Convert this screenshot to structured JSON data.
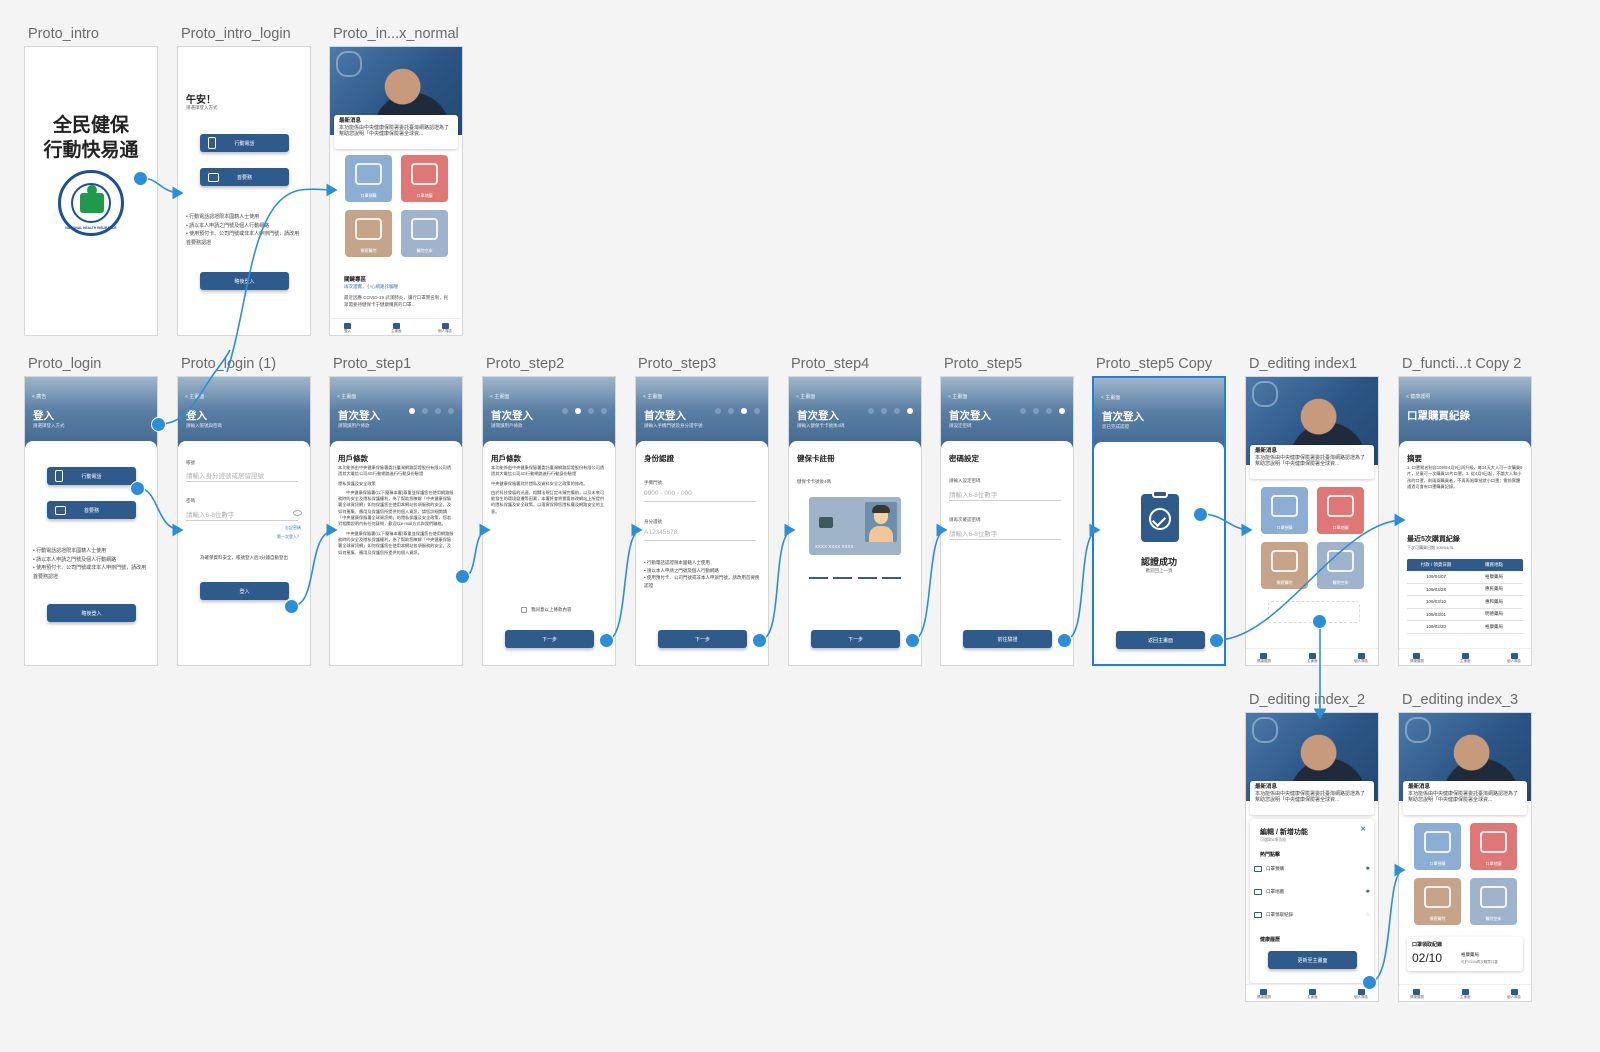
{
  "artboards": {
    "intro": "Proto_intro",
    "intro_login": "Proto_intro_login",
    "index_normal": "Proto_in...x_normal",
    "login": "Proto_login",
    "login1": "Proto_login (1)",
    "step1": "Proto_step1",
    "step2": "Proto_step2",
    "step3": "Proto_step3",
    "step4": "Proto_step4",
    "step5": "Proto_step5",
    "step5copy": "Proto_step5 Copy",
    "editing1": "D_editing index1",
    "functcopy": "D_functi...t Copy 2",
    "editing2": "D_editing index_2",
    "editing3": "D_editing index_3"
  },
  "intro": {
    "title1": "全民健保",
    "title2": "行動快易通",
    "logo_text": "NATIONAL HEALTH INSURANCE"
  },
  "intro_login": {
    "greeting": "午安！",
    "sub": "請選擇登入方式",
    "btn_phone": "行動電話",
    "btn_card": "首要務",
    "bullets": [
      "• 行動電話認證限本國籍人士使用",
      "• 請以本人申請之門號及個人行動網路",
      "• 使用預付卡、公司門號或非本人申辦門號，請改用首要務認證"
    ],
    "btn_skip": "略後登入"
  },
  "news": {
    "title": "最新消息",
    "body": "本功能係由中央健康保險署委託臺灣網路認證為了幫助您說明「中央健康保險署全球資..."
  },
  "tiles": {
    "mask": "口罩預購",
    "map": "口罩地圖",
    "hosp": "療癒醫院",
    "bed": "醫院空床"
  },
  "index_normal": {
    "topics": "關鍵專區",
    "topic_link": "再次證實，小心網路詐騙喔",
    "topic_body": "最近因應 COVID-19 武漢肺炎，讓行口罩實名制，民眾需要持健保卡于健康購買的口罩...",
    "nav": [
      "登入",
      "主畫面",
      "個人專區"
    ]
  },
  "login": {
    "back": "< 廣告",
    "title": "登入",
    "sub": "請選擇登入方式",
    "btn_phone": "行動電話",
    "btn_card": "首要務",
    "bullets": [
      "• 行動電話認證限本國籍人士使用",
      "• 請以本人申請之門號及個人行動網路",
      "• 使用預付卡、公司門號或非本人申辦門號，請改用首要務認證"
    ],
    "btn_skip": "略後登入"
  },
  "login1": {
    "back": "< 主畫面",
    "title": "登入",
    "sub": "請輸入帳號與密碼",
    "acct_label": "帳號",
    "acct_ph": "請輸入身分證號或居留證號",
    "pwd_label": "密碼",
    "pwd_ph": "請輸入6-8位數字",
    "forgot": "忘記密碼",
    "first": "第一次登入？",
    "note": "為確保資料安全，帳號登入后3分鐘自動登出",
    "btn": "登入"
  },
  "step1": {
    "back": "< 主畫面",
    "title": "首次登入",
    "sub": "請閱讀用戶條款",
    "section": "用戶條款",
    "p1": "本功能係由中央健康保險署委託臺灣網路認證股份有限公司透過其大電信公司4G行動網路進行行動身份驗證",
    "sub2": "隱私保護及安全政策",
    "p2": "中央健康保險署(以下簡稱本署)尊重並保護您在使用網路服務時的安全及隱私保護權利，為了幫助您瞭解「中央健康保險署全球資訊網」如何保護您在使用本網站各項服務的安全，及如何蒐集、應用及保護您所提供的個人資訊，請您詳細閱讀「中央健康保險署全球資訊網」的隱私保護及安全政策，您若對相關說明內有任何疑問，歡迎以e-mail方式與我們聯絡。",
    "p3": "中央健康保險署(以下簡稱本署)尊重並保護您在使用網路服務時的安全及隱私保護權利，為了幫助您瞭解「中央健康保險署全球資訊網」如何保護您在使用本網站各項服務的安全，及如何蒐集、應用及保護您所提供的個人資訊。"
  },
  "step2": {
    "back": "< 主畫面",
    "title": "首次登入",
    "sub": "請閱讀用戶條款",
    "section": "用戶條款",
    "p1": "本功能係由中央健康保險署委託臺灣網路認證股份有限公司透過其大電信公司4G行動網路進行行動身份驗證",
    "p2": "中央健康保險署對於隱私及資料安全之政策的修改。",
    "p3": "由於科技發展的迅速，相關法規訂定未臻完備前，以及未來可能發生的環境變遷等因素，本署將會將需要修改網站上所提供的隱私保護及安全政策，以落實保障您隱私權及網路安全的立意。",
    "agree": "我同意以上條款內容",
    "btn": "下一步"
  },
  "step3": {
    "back": "< 主畫面",
    "title": "首次登入",
    "sub": "請輸入手機門號及身分證字號",
    "section": "身份認證",
    "phone_label": "手機門號",
    "phone_ph": "0900 - 000 - 000",
    "id_label": "身分證號",
    "id_ph": "A12345678",
    "bullets": [
      "• 行動電話認證限本國籍人士使用",
      "• 請以本人申請之門號及個人行動網路",
      "• 使用預付卡、公司門號或非本人申辦門號，請改用首要務認證"
    ],
    "btn": "下一步"
  },
  "step4": {
    "back": "< 主畫面",
    "title": "首次登入",
    "sub": "請輸入健保卡卡號後4碼",
    "section": "健保卡註冊",
    "label": "健保卡卡號後4碼",
    "card_no": "XXXX XXXX XXXX",
    "btn": "下一步"
  },
  "step5": {
    "back": "< 主畫面",
    "title": "首次登入",
    "sub": "請設定密碼",
    "section": "密碼設定",
    "pwd_label": "請輸入設定密碼",
    "pwd_ph": "請輸入6-8位數字",
    "pwd2_label": "請再次確認密碼",
    "pwd2_ph": "請輸入6-8位數字",
    "btn": "前往驗證"
  },
  "step5copy": {
    "back": "< 主畫面",
    "title": "首次登入",
    "sub": "您已完成認證",
    "success": "認證成功",
    "success_sub": "歡迎回上一頁",
    "btn": "返回主畫面"
  },
  "funct": {
    "back": "< 健康護照",
    "title": "口罩購買紀錄",
    "sum_title": "摘要",
    "sum_body": "1. 口罩實名制自109年4月9日再升級，每14天大人可一次購買9片，兒童可一次購買10片口罩。2. 從4月9日起，不論大人和小孩的口罩，則兩兩購買者，不再再限單批就小口罩；需前實體通過可會有口罩購買記錄。",
    "hist_title": "最近5次購買紀錄",
    "hist_sub": "下次可購買日期 109/04/31",
    "headers": [
      "付款 / 領貨日期",
      "購買地點"
    ],
    "rows": [
      [
        "109/04/07",
        "裕康藥局"
      ],
      [
        "109/03/28",
        "惠民藥局"
      ],
      [
        "109/03/10",
        "惠和藥局"
      ],
      [
        "109/03/01",
        "明德藥局"
      ],
      [
        "109/02/20",
        "裕康藥局"
      ]
    ]
  },
  "editing2": {
    "title": "編輯 / 新增功能",
    "sub": "可選取8項功能",
    "popular": "熱門點擊",
    "items": [
      "口罩預購",
      "口罩地圖",
      "口罩領取紀錄"
    ],
    "health": "健康履歷",
    "btn": "更新至主畫面"
  },
  "editing3": {
    "record_title": "口罩領取紀錄",
    "date": "02/10",
    "place": "裕康藥局",
    "place_sub": "可於03/24再次購買口罩"
  },
  "nav_items": [
    "健康護照",
    "主畫面",
    "個人專區"
  ]
}
